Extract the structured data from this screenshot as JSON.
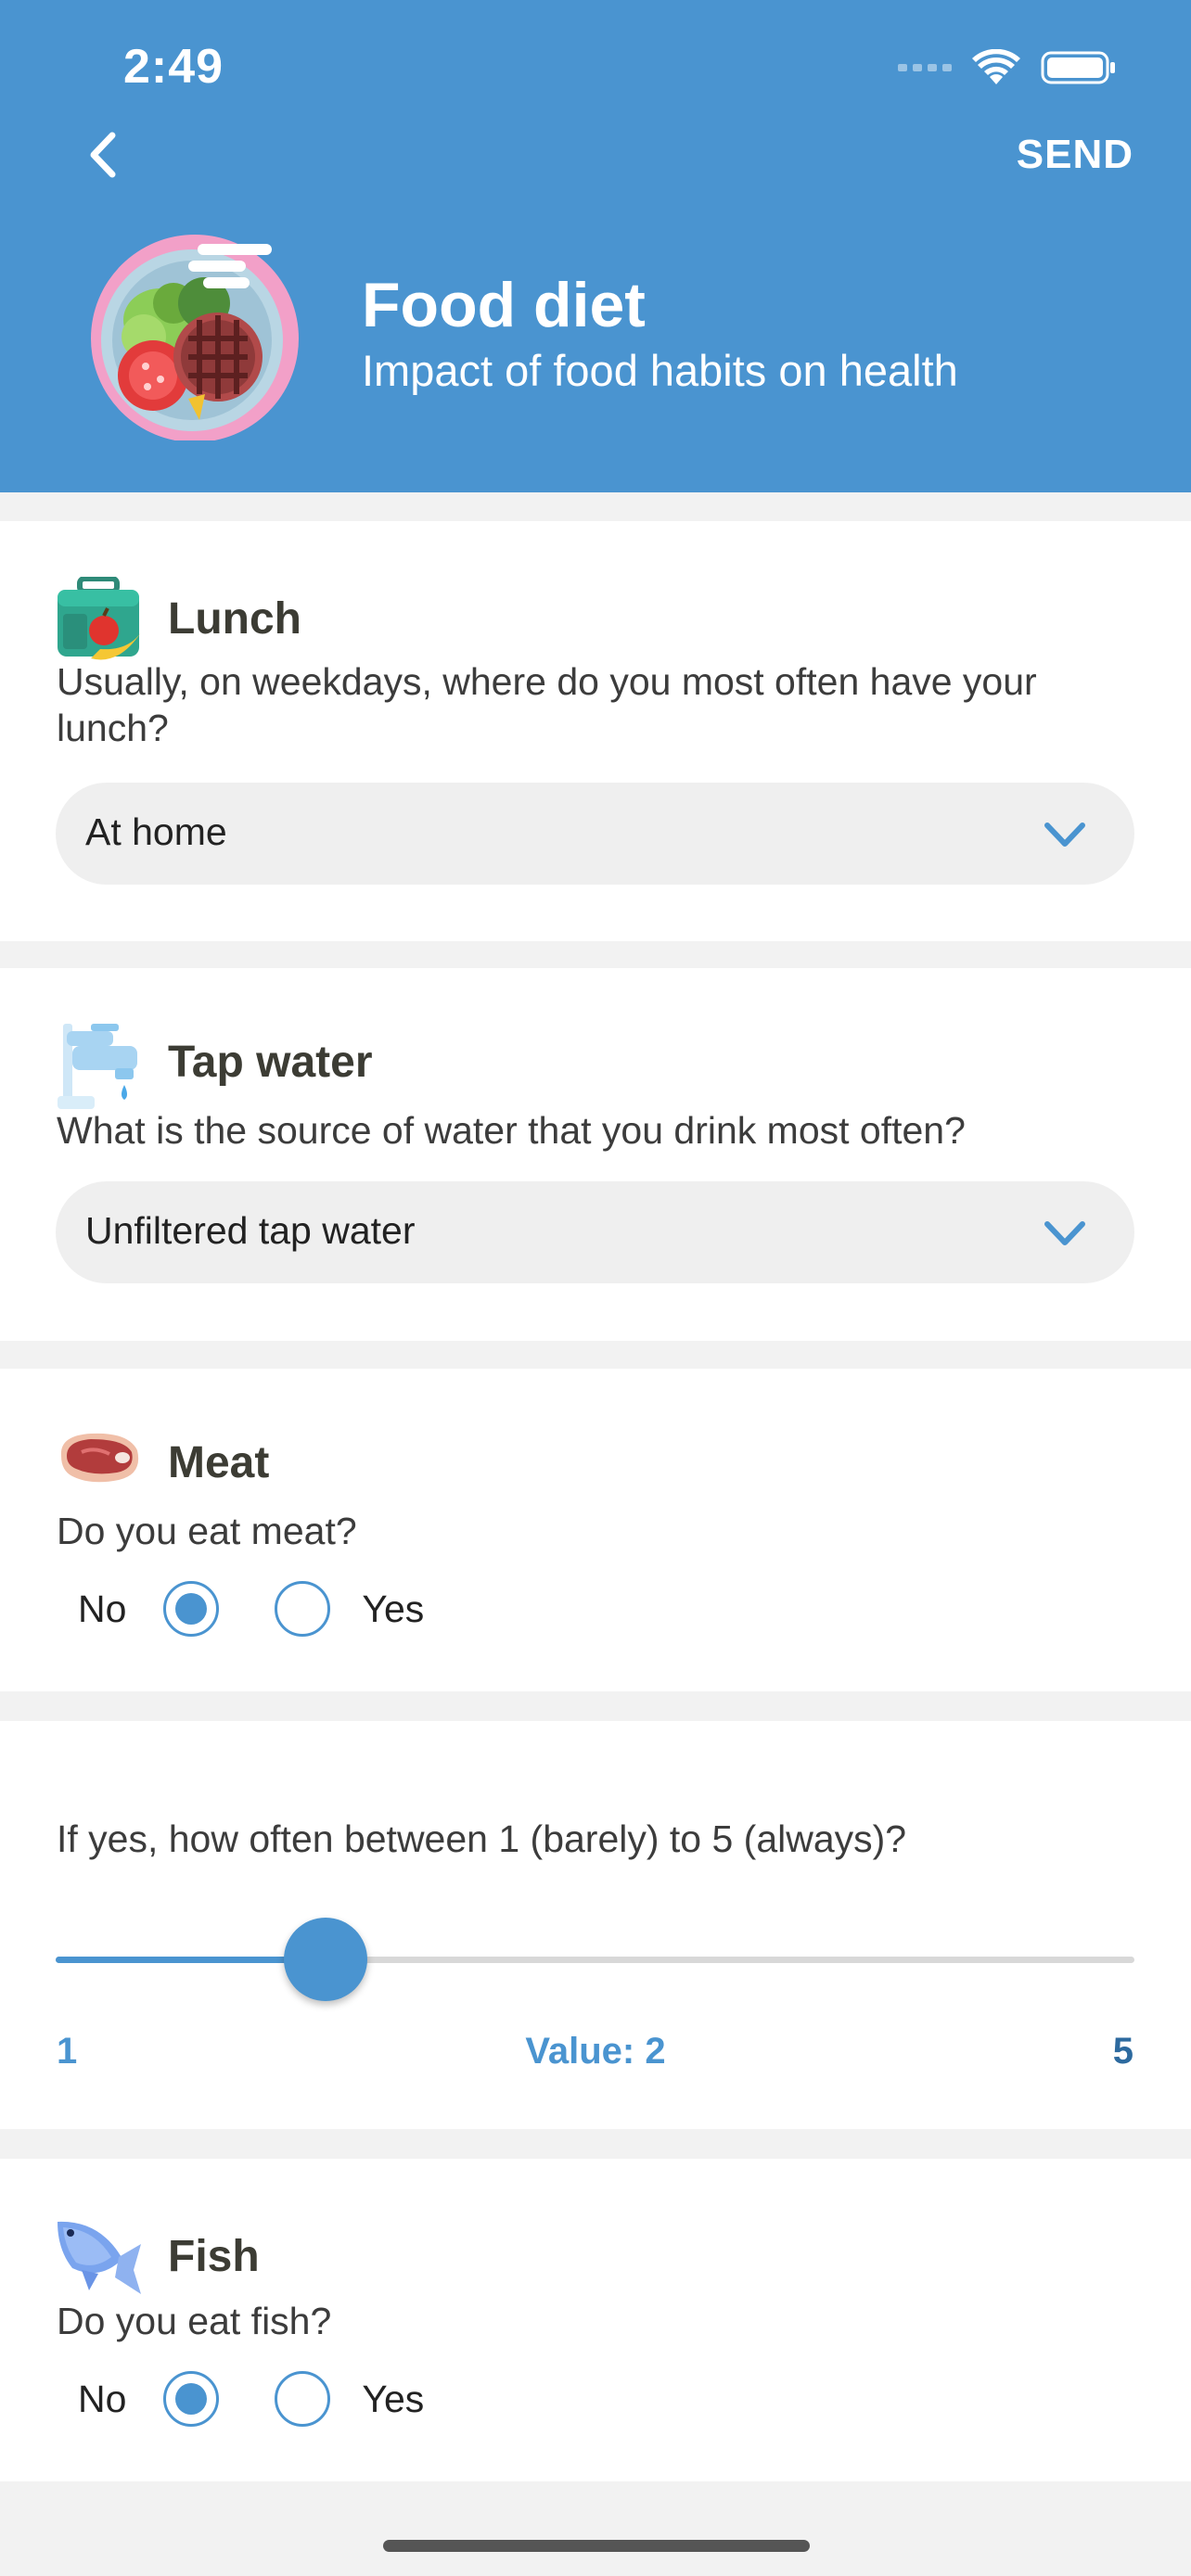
{
  "status_bar": {
    "time": "2:49"
  },
  "header": {
    "send_label": "SEND",
    "title": "Food diet",
    "subtitle": "Impact of food habits on health"
  },
  "lunch": {
    "title": "Lunch",
    "question": "Usually, on weekdays, where do you most often have your lunch?",
    "selected": "At home"
  },
  "tap_water": {
    "title": "Tap water",
    "question": "What is the source of water that you drink most often?",
    "selected": "Unfiltered tap water"
  },
  "meat": {
    "title": "Meat",
    "question": "Do you eat meat?",
    "options": [
      "No",
      "Yes"
    ],
    "selected": "No"
  },
  "meat_frequency": {
    "question": "If yes, how often between 1 (barely) to 5 (always)?",
    "min_label": "1",
    "max_label": "5",
    "value_label": "Value: 2",
    "min": 1,
    "max": 5,
    "value": 2
  },
  "fish": {
    "title": "Fish",
    "question": "Do you eat fish?",
    "options": [
      "No",
      "Yes"
    ],
    "selected": "No"
  },
  "colors": {
    "accent": "#4a94d0",
    "background": "#f2f2f2",
    "card": "#ffffff"
  },
  "icons": {
    "back": "chevron-left-icon",
    "select": "chevron-down-icon",
    "header": "food-plate-icon",
    "lunch": "lunchbox-icon",
    "tap_water": "faucet-icon",
    "meat": "steak-icon",
    "fish": "fish-icon"
  }
}
